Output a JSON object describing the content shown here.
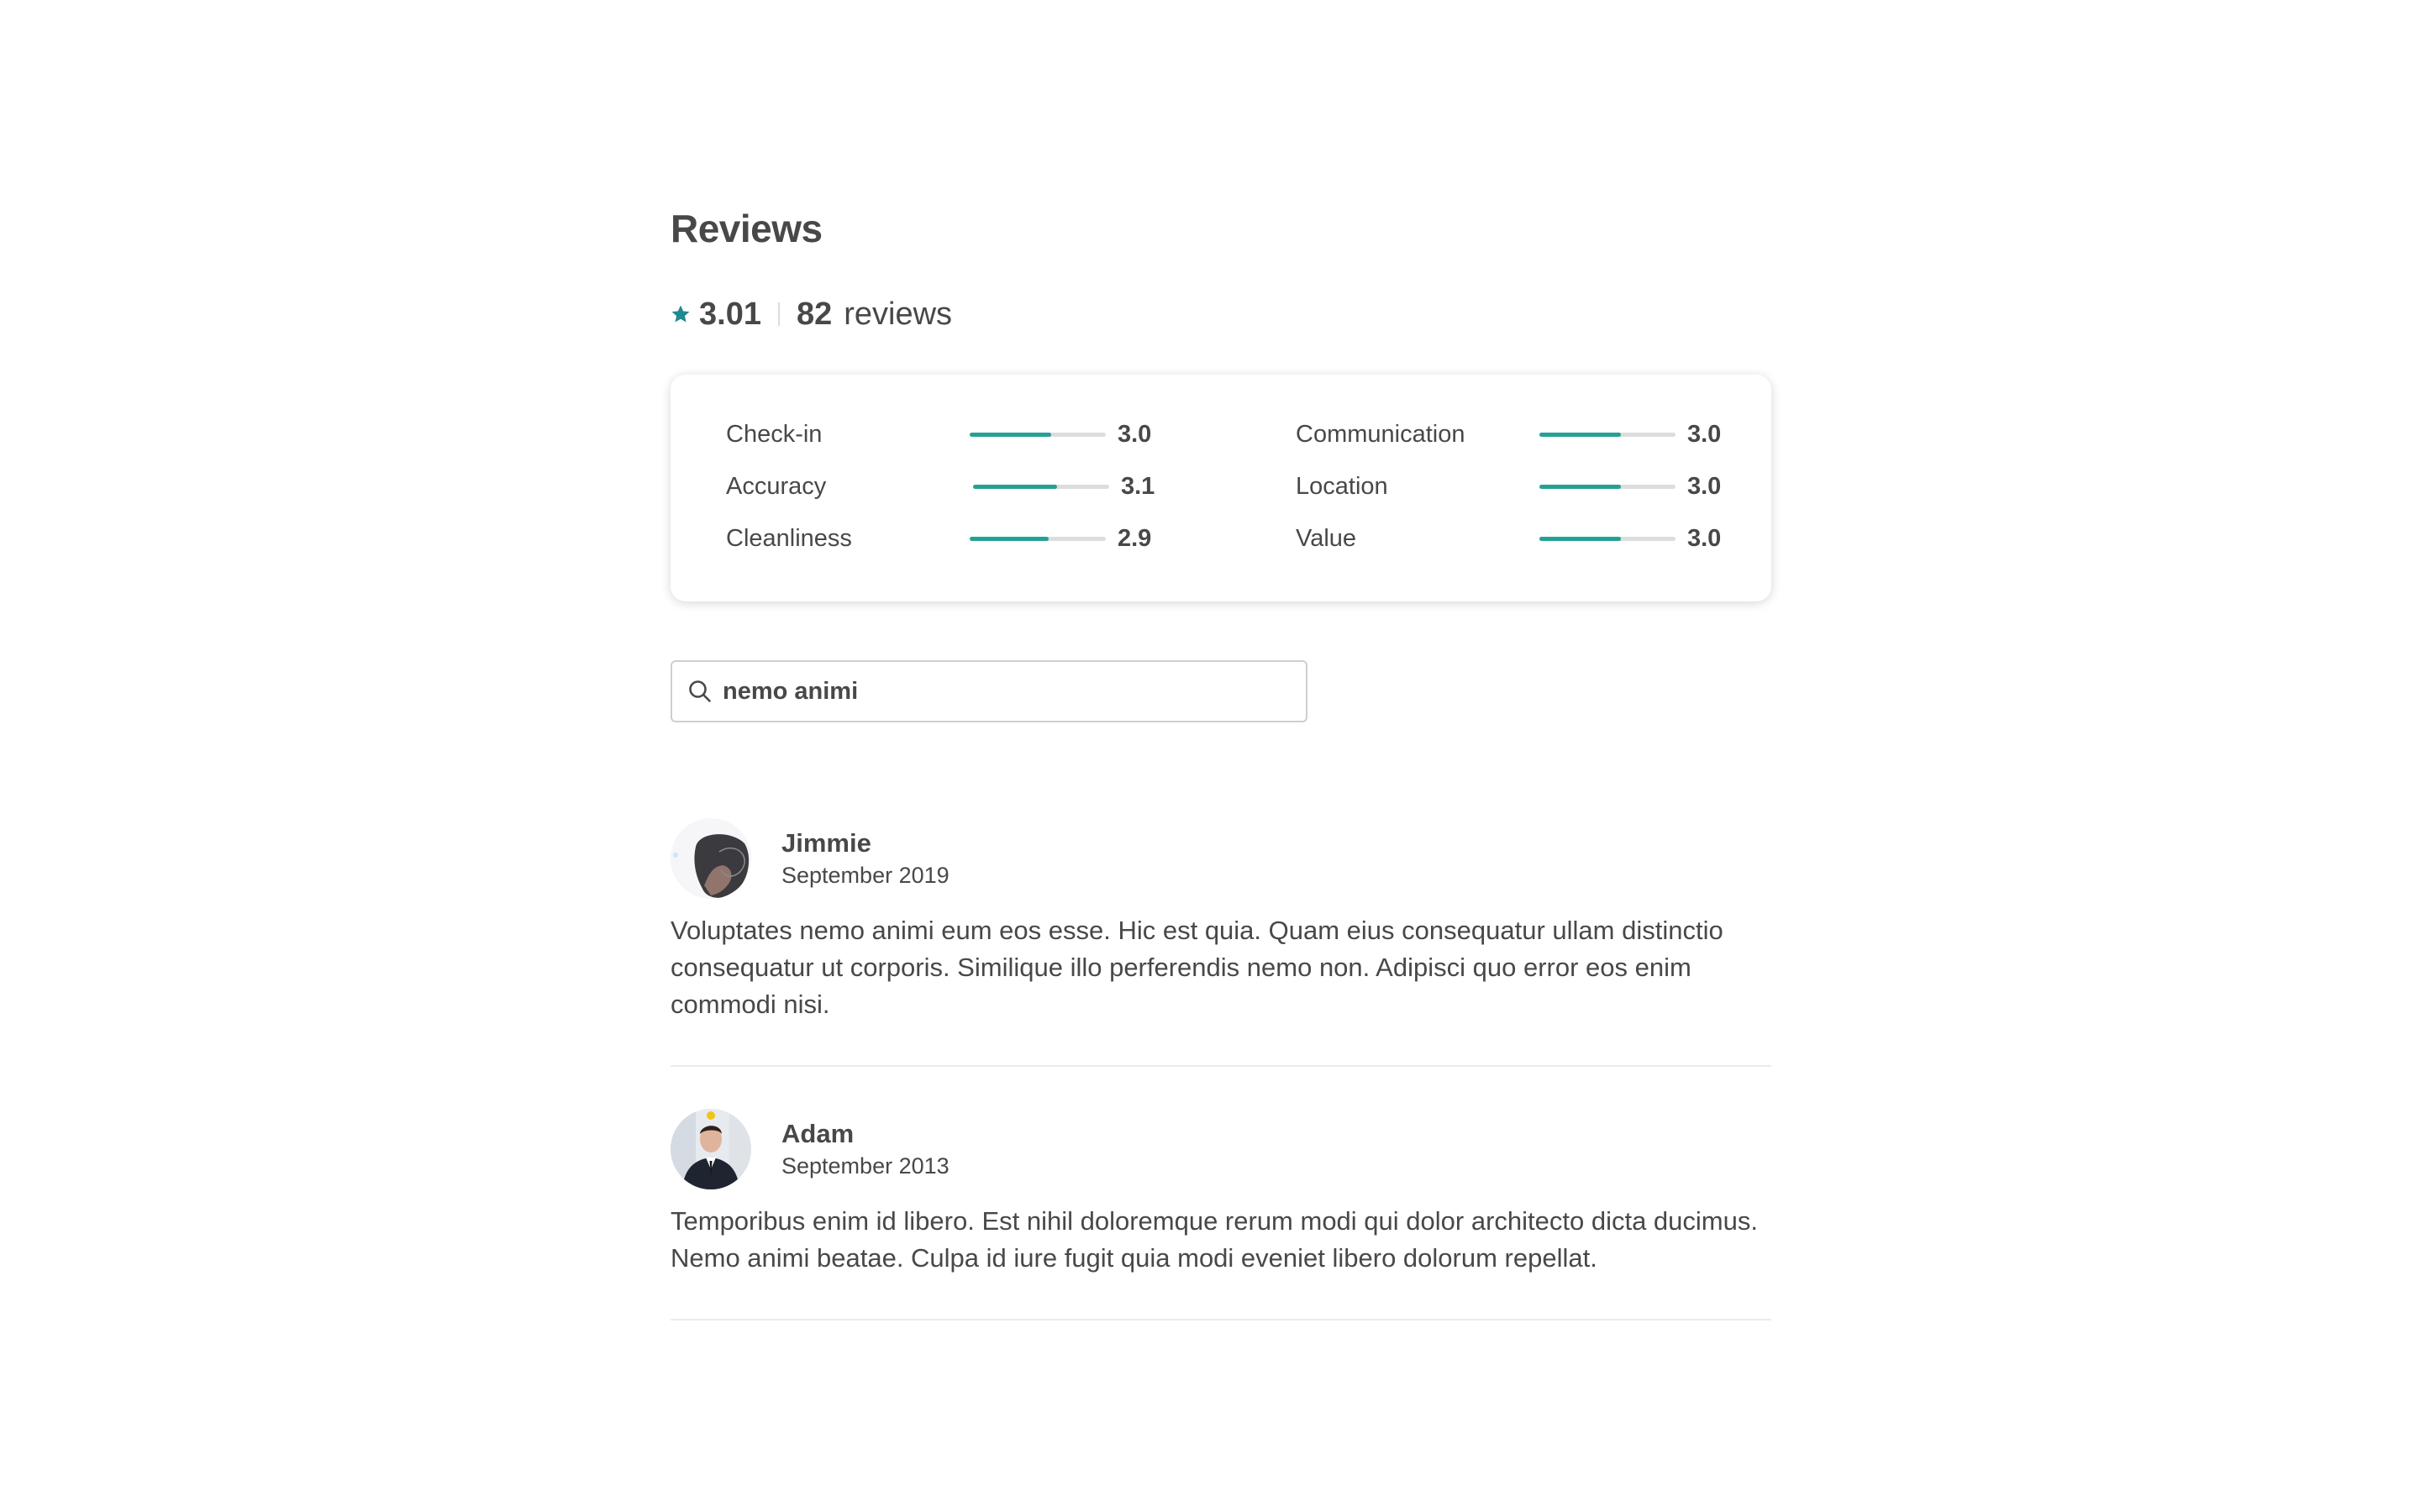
{
  "reviews_section": {
    "heading": "Reviews",
    "average_rating": "3.01",
    "review_count": "82",
    "review_count_label": "reviews"
  },
  "ratings": {
    "left": [
      {
        "label": "Check-in",
        "value": "3.0",
        "level": 0.6
      },
      {
        "label": "Accuracy",
        "value": "3.1",
        "level": 0.62
      },
      {
        "label": "Cleanliness",
        "value": "2.9",
        "level": 0.58
      }
    ],
    "right": [
      {
        "label": "Communication",
        "value": "3.0",
        "level": 0.6
      },
      {
        "label": "Location",
        "value": "3.0",
        "level": 0.6
      },
      {
        "label": "Value",
        "value": "3.0",
        "level": 0.6
      }
    ]
  },
  "search": {
    "value": "nemo animi",
    "icon": "search-icon"
  },
  "reviews": [
    {
      "name": "Jimmie",
      "date": "September 2019",
      "text": "Voluptates nemo animi eum eos esse. Hic est quia. Quam eius consequatur ullam distinctio consequatur ut corporis. Similique illo perferendis nemo non. Adipisci quo error eos enim commodi nisi."
    },
    {
      "name": "Adam",
      "date": "September 2013",
      "text": "Temporibus enim id libero. Est nihil doloremque rerum modi qui dolor architecto dicta ducimus. Nemo animi beatae. Culpa id iure fugit quia modi eveniet libero dolorum repellat."
    }
  ],
  "colors": {
    "accent": "#25a094",
    "text": "#484848",
    "track": "#dddddd"
  }
}
